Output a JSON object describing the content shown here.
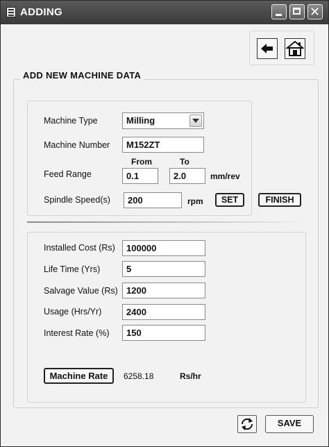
{
  "window": {
    "title": "ADDING"
  },
  "group_title": "ADD NEW MACHINE DATA",
  "machine": {
    "type_label": "Machine Type",
    "type_value": "Milling",
    "number_label": "Machine Number",
    "number_value": "M152ZT",
    "feed_label": "Feed Range",
    "feed_from_header": "From",
    "feed_to_header": "To",
    "feed_from_value": "0.1",
    "feed_to_value": "2.0",
    "feed_unit": "mm/rev",
    "spindle_label": "Spindle Speed(s)",
    "spindle_value": "200",
    "spindle_unit": "rpm",
    "set_label": "SET",
    "finish_label": "FINISH"
  },
  "cost": {
    "installed_label": "Installed Cost (Rs)",
    "installed_value": "100000",
    "life_label": "Life Time (Yrs)",
    "life_value": "5",
    "salvage_label": "Salvage Value (Rs)",
    "salvage_value": "1200",
    "usage_label": "Usage (Hrs/Yr)",
    "usage_value": "2400",
    "interest_label": "Interest Rate (%)",
    "interest_value": "150",
    "rate_button_label": "Machine Rate",
    "rate_value": "6258.18",
    "rate_unit": "Rs/hr"
  },
  "footer": {
    "save_label": "SAVE"
  },
  "icons": {
    "app": "window-app-icon",
    "back": "arrow-left-icon",
    "home": "home-icon",
    "refresh": "refresh-icon"
  }
}
